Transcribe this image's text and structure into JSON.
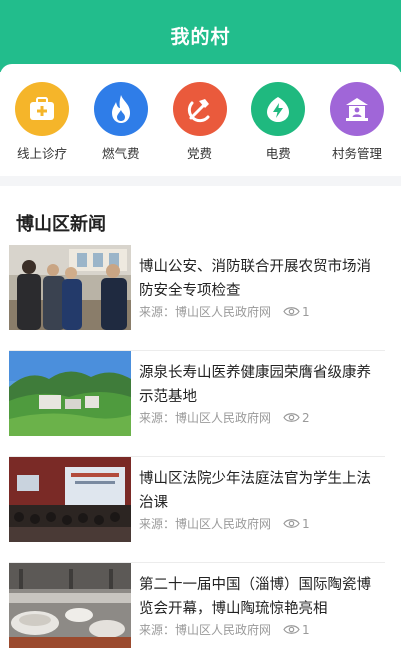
{
  "header": {
    "title": "我的村"
  },
  "services": [
    {
      "label": "线上诊疗",
      "icon": "medical-kit-icon",
      "color": "#f5b52a"
    },
    {
      "label": "燃气费",
      "icon": "flame-icon",
      "color": "#2f7de8"
    },
    {
      "label": "党费",
      "icon": "hammer-sickle-icon",
      "color": "#ea5a3c"
    },
    {
      "label": "电费",
      "icon": "electricity-bolt-icon",
      "color": "#1fb97f"
    },
    {
      "label": "村务管理",
      "icon": "village-hall-icon",
      "color": "#a066d8"
    }
  ],
  "news": {
    "title": "博山区新闻",
    "items": [
      {
        "title": "博山公安、消防联合开展农贸市场消防安全专项检查",
        "source": "来源：博山区人民政府网",
        "views": "1"
      },
      {
        "title": "源泉长寿山医养健康园荣膺省级康养示范基地",
        "source": "来源：博山区人民政府网",
        "views": "2"
      },
      {
        "title": "博山区法院少年法庭法官为学生上法治课",
        "source": "来源：博山区人民政府网",
        "views": "1"
      },
      {
        "title": "第二十一届中国（淄博）国际陶瓷博览会开幕，博山陶琉惊艳亮相",
        "source": "来源：博山区人民政府网",
        "views": "1"
      }
    ]
  }
}
